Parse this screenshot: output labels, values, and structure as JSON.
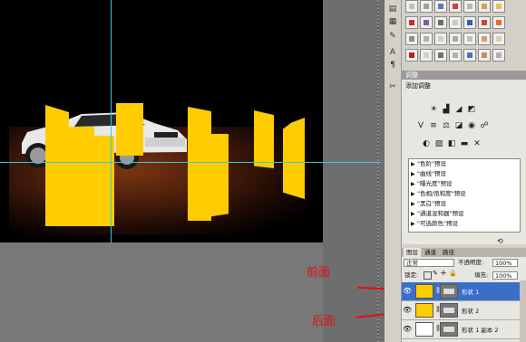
{
  "adjustments_panel": {
    "title": "调整",
    "subtitle": "添加调整",
    "presets": [
      "\"色阶\"预设",
      "\"曲线\"预设",
      "\"曝光度\"预设",
      "\"色相/饱和度\"预设",
      "\"黑白\"预设",
      "\"通道混和器\"预设",
      "\"可选颜色\"预设"
    ]
  },
  "layers_panel": {
    "tabs": [
      "图层",
      "通道",
      "路径"
    ],
    "blend_mode": "正常",
    "opacity_label": "不透明度:",
    "opacity_value": "100%",
    "lock_label": "锁定:",
    "fill_label": "填充:",
    "fill_value": "100%",
    "layers": [
      {
        "name": "形状 1",
        "selected": true,
        "thumb_color": "#ffcc00"
      },
      {
        "name": "形状 2",
        "selected": false,
        "thumb_color": "#ffcc00"
      },
      {
        "name": "形状 1 副本 2",
        "selected": false,
        "thumb_color": "#ffffff"
      }
    ]
  },
  "annotations": {
    "front": "前面",
    "back": "后面"
  },
  "colors": {
    "shape_yellow": "#ffcc00",
    "guide": "#3cc8d8",
    "annotation_red": "#e01010",
    "selection_blue": "#3a6fc8"
  }
}
